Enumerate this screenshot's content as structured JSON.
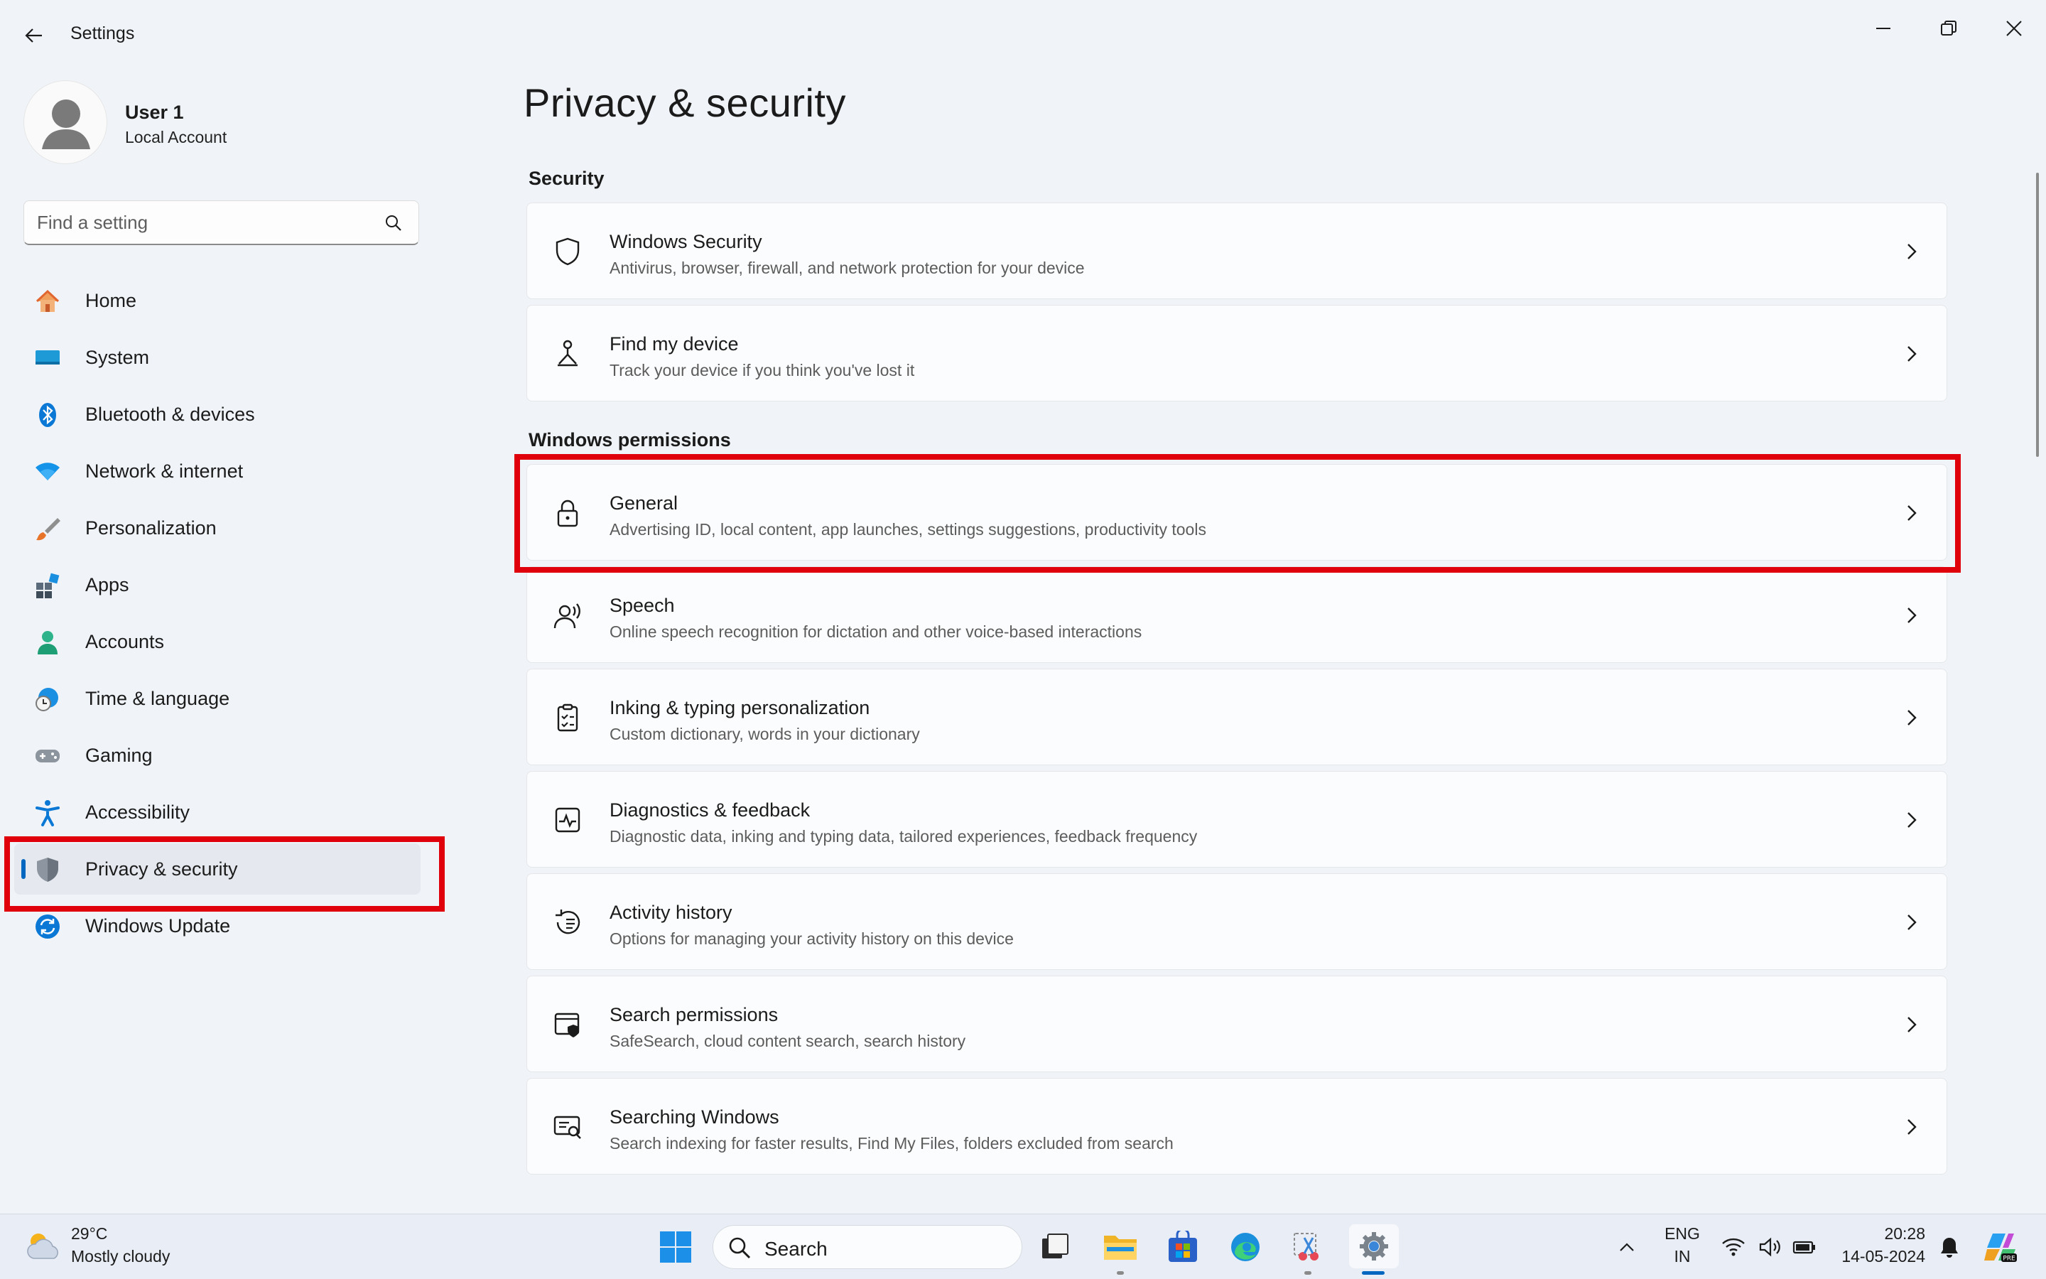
{
  "window": {
    "title": "Settings"
  },
  "user": {
    "name": "User 1",
    "account_type": "Local Account"
  },
  "search": {
    "placeholder": "Find a setting"
  },
  "nav": {
    "items": [
      {
        "label": "Home",
        "icon": "home-icon"
      },
      {
        "label": "System",
        "icon": "system-icon"
      },
      {
        "label": "Bluetooth & devices",
        "icon": "bluetooth-icon"
      },
      {
        "label": "Network & internet",
        "icon": "wifi-icon"
      },
      {
        "label": "Personalization",
        "icon": "brush-icon"
      },
      {
        "label": "Apps",
        "icon": "apps-icon"
      },
      {
        "label": "Accounts",
        "icon": "person-icon"
      },
      {
        "label": "Time & language",
        "icon": "globe-clock-icon"
      },
      {
        "label": "Gaming",
        "icon": "gamepad-icon"
      },
      {
        "label": "Accessibility",
        "icon": "accessibility-icon"
      },
      {
        "label": "Privacy & security",
        "icon": "shield-icon",
        "selected": true
      },
      {
        "label": "Windows Update",
        "icon": "update-icon"
      }
    ]
  },
  "main": {
    "title": "Privacy & security",
    "sections": [
      {
        "title": "Security",
        "items": [
          {
            "title": "Windows Security",
            "description": "Antivirus, browser, firewall, and network protection for your device",
            "icon": "shield-outline-icon"
          },
          {
            "title": "Find my device",
            "description": "Track your device if you think you've lost it",
            "icon": "find-device-icon"
          }
        ]
      },
      {
        "title": "Windows permissions",
        "items": [
          {
            "title": "General",
            "description": "Advertising ID, local content, app launches, settings suggestions, productivity tools",
            "icon": "lock-icon"
          },
          {
            "title": "Speech",
            "description": "Online speech recognition for dictation and other voice-based interactions",
            "icon": "speech-icon"
          },
          {
            "title": "Inking & typing personalization",
            "description": "Custom dictionary, words in your dictionary",
            "icon": "clipboard-check-icon"
          },
          {
            "title": "Diagnostics & feedback",
            "description": "Diagnostic data, inking and typing data, tailored experiences, feedback frequency",
            "icon": "diagnostics-icon"
          },
          {
            "title": "Activity history",
            "description": "Options for managing your activity history on this device",
            "icon": "history-icon"
          },
          {
            "title": "Search permissions",
            "description": "SafeSearch, cloud content search, search history",
            "icon": "search-shield-icon"
          },
          {
            "title": "Searching Windows",
            "description": "Search indexing for faster results, Find My Files, folders excluded from search",
            "icon": "search-windows-icon"
          }
        ]
      }
    ]
  },
  "taskbar": {
    "weather": {
      "temp": "29°C",
      "condition": "Mostly cloudy"
    },
    "search_label": "Search",
    "language": {
      "line1": "ENG",
      "line2": "IN"
    },
    "clock": {
      "time": "20:28",
      "date": "14-05-2024"
    }
  },
  "colors": {
    "accent": "#0067c0",
    "highlight": "#e0000b",
    "background": "#f0f4f9"
  }
}
